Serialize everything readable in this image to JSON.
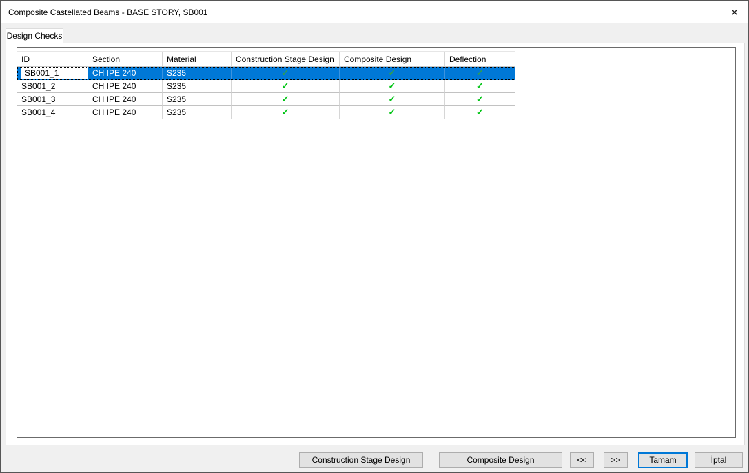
{
  "window": {
    "title": "Composite Castellated Beams - BASE STORY, SB001",
    "close_glyph": "✕"
  },
  "tabs": [
    {
      "label": "Design Checks",
      "active": true
    }
  ],
  "grid": {
    "columns": [
      {
        "label": "ID"
      },
      {
        "label": "Section"
      },
      {
        "label": "Material"
      },
      {
        "label": "Construction Stage Design"
      },
      {
        "label": "Composite Design"
      },
      {
        "label": "Deflection"
      }
    ],
    "check_glyph": "✓",
    "rows": [
      {
        "id": "SB001_1",
        "section": "CH IPE 240",
        "material": "S235",
        "construction_stage_design": "pass",
        "composite_design": "pass",
        "deflection": "pass",
        "selected": true
      },
      {
        "id": "SB001_2",
        "section": "CH IPE 240",
        "material": "S235",
        "construction_stage_design": "pass",
        "composite_design": "pass",
        "deflection": "pass",
        "selected": false
      },
      {
        "id": "SB001_3",
        "section": "CH IPE 240",
        "material": "S235",
        "construction_stage_design": "pass",
        "composite_design": "pass",
        "deflection": "pass",
        "selected": false
      },
      {
        "id": "SB001_4",
        "section": "CH IPE 240",
        "material": "S235",
        "construction_stage_design": "pass",
        "composite_design": "pass",
        "deflection": "pass",
        "selected": false
      }
    ]
  },
  "footer": {
    "buttons": [
      {
        "label": "Construction Stage Design"
      },
      {
        "label": "Composite Design"
      },
      {
        "label": "<<"
      },
      {
        "label": ">>"
      },
      {
        "label": "Tamam",
        "default": true
      },
      {
        "label": "İptal"
      }
    ]
  },
  "colors": {
    "selection_blue": "#0078D7",
    "check_green": "#00C414",
    "check_green_selected": "#2E9E52",
    "dialog_background": "#F0F0F0",
    "panel_border": "#6B6B6B"
  }
}
